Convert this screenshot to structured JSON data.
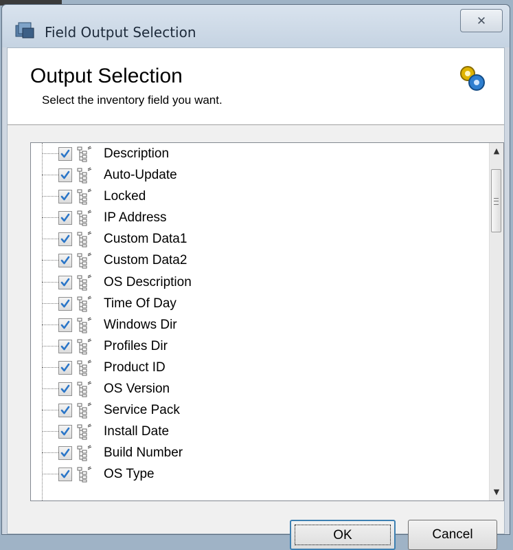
{
  "window": {
    "title": "Field Output Selection",
    "close_glyph": "✕"
  },
  "header": {
    "title": "Output Selection",
    "subtitle": "Select the inventory field you want.",
    "icon": "gears-icon"
  },
  "tree": {
    "items": [
      {
        "label": "Description",
        "checked": true
      },
      {
        "label": "Auto-Update",
        "checked": true
      },
      {
        "label": "Locked",
        "checked": true
      },
      {
        "label": "IP Address",
        "checked": true
      },
      {
        "label": "Custom Data1",
        "checked": true
      },
      {
        "label": "Custom Data2",
        "checked": true
      },
      {
        "label": "OS Description",
        "checked": true
      },
      {
        "label": "Time Of Day",
        "checked": true
      },
      {
        "label": "Windows Dir",
        "checked": true
      },
      {
        "label": "Profiles Dir",
        "checked": true
      },
      {
        "label": "Product ID",
        "checked": true
      },
      {
        "label": "OS Version",
        "checked": true
      },
      {
        "label": "Service Pack",
        "checked": true
      },
      {
        "label": "Install Date",
        "checked": true
      },
      {
        "label": "Build Number",
        "checked": true
      },
      {
        "label": "OS Type",
        "checked": true
      }
    ]
  },
  "buttons": {
    "ok_label": "OK",
    "cancel_label": "Cancel"
  },
  "colors": {
    "check": "#2b76c8",
    "title_text": "#1d2a3a"
  }
}
